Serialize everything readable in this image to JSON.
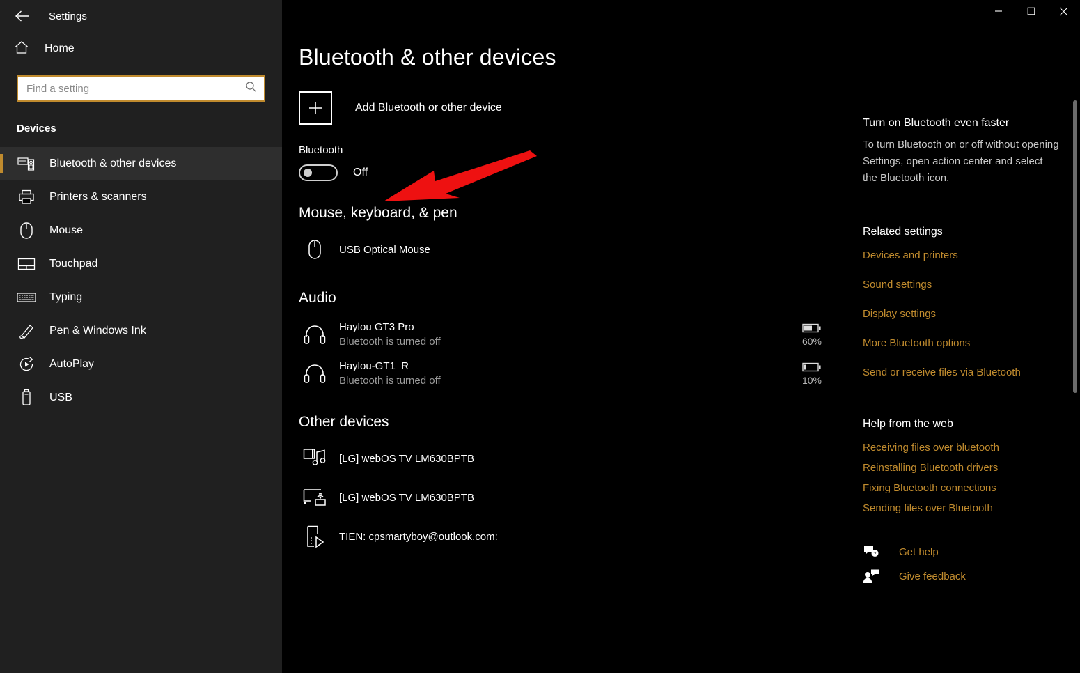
{
  "window": {
    "title": "Settings",
    "back_icon": "back-arrow-icon",
    "controls": {
      "minimize": "minimize-icon",
      "maximize": "maximize-icon",
      "close": "close-icon"
    }
  },
  "sidebar": {
    "home_label": "Home",
    "home_icon": "home-icon",
    "search": {
      "placeholder": "Find a setting",
      "value": "",
      "icon": "search-icon"
    },
    "category": "Devices",
    "accent_color": "#c08b2e",
    "items": [
      {
        "label": "Bluetooth & other devices",
        "icon": "bluetooth-devices-icon",
        "selected": true
      },
      {
        "label": "Printers & scanners",
        "icon": "printer-icon",
        "selected": false
      },
      {
        "label": "Mouse",
        "icon": "mouse-icon",
        "selected": false
      },
      {
        "label": "Touchpad",
        "icon": "touchpad-icon",
        "selected": false
      },
      {
        "label": "Typing",
        "icon": "keyboard-icon",
        "selected": false
      },
      {
        "label": "Pen & Windows Ink",
        "icon": "pen-icon",
        "selected": false
      },
      {
        "label": "AutoPlay",
        "icon": "autoplay-icon",
        "selected": false
      },
      {
        "label": "USB",
        "icon": "usb-icon",
        "selected": false
      }
    ]
  },
  "main": {
    "page_title": "Bluetooth & other devices",
    "add_device": {
      "label": "Add Bluetooth or other device",
      "icon": "plus-icon"
    },
    "bluetooth": {
      "label": "Bluetooth",
      "state": "Off",
      "enabled": false
    },
    "groups": [
      {
        "heading": "Mouse, keyboard, & pen",
        "devices": [
          {
            "name": "USB Optical Mouse",
            "status": "",
            "icon": "mouse-icon",
            "battery": ""
          }
        ]
      },
      {
        "heading": "Audio",
        "devices": [
          {
            "name": "Haylou GT3 Pro",
            "status": "Bluetooth is turned off",
            "icon": "headphones-icon",
            "battery": "60%"
          },
          {
            "name": "Haylou-GT1_R",
            "status": "Bluetooth is turned off",
            "icon": "headphones-icon",
            "battery": "10%"
          }
        ]
      },
      {
        "heading": "Other devices",
        "devices": [
          {
            "name": "[LG] webOS TV LM630BPTB",
            "status": "",
            "icon": "media-device-icon",
            "battery": ""
          },
          {
            "name": "[LG] webOS TV LM630BPTB",
            "status": "",
            "icon": "cast-display-icon",
            "battery": ""
          },
          {
            "name": "TIEN: cpsmartyboy@outlook.com:",
            "status": "",
            "icon": "phone-media-icon",
            "battery": ""
          }
        ]
      }
    ]
  },
  "right_panel": {
    "tip_title": "Turn on Bluetooth even faster",
    "tip_body": "To turn Bluetooth on or off without opening Settings, open action center and select the Bluetooth icon.",
    "related_heading": "Related settings",
    "related_links": [
      "Devices and printers",
      "Sound settings",
      "Display settings",
      "More Bluetooth options",
      "Send or receive files via Bluetooth"
    ],
    "help_heading": "Help from the web",
    "help_links": [
      "Receiving files over bluetooth",
      "Reinstalling Bluetooth drivers",
      "Fixing Bluetooth connections",
      "Sending files over Bluetooth"
    ],
    "footer": [
      {
        "label": "Get help",
        "icon": "get-help-icon"
      },
      {
        "label": "Give feedback",
        "icon": "give-feedback-icon"
      }
    ],
    "link_color": "#c08b2e"
  },
  "annotation": {
    "type": "arrow",
    "color": "#ee1111",
    "points_at": "bluetooth-toggle"
  }
}
